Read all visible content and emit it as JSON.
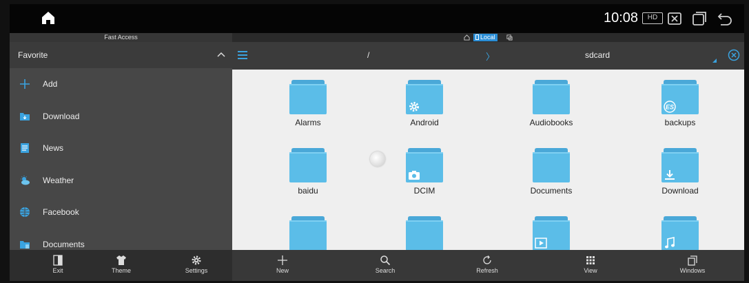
{
  "status_bar": {
    "time": "10:08",
    "hd_label": "HD",
    "icons": [
      "home-icon",
      "screenshot-icon",
      "recent-apps-icon",
      "back-icon"
    ]
  },
  "sidebar": {
    "header": "Fast Access",
    "section_title": "Favorite",
    "items": [
      {
        "label": "Add",
        "icon": "plus-icon"
      },
      {
        "label": "Download",
        "icon": "download-folder-icon"
      },
      {
        "label": "News",
        "icon": "news-icon"
      },
      {
        "label": "Weather",
        "icon": "weather-icon"
      },
      {
        "label": "Facebook",
        "icon": "globe-icon"
      },
      {
        "label": "Documents",
        "icon": "documents-icon"
      }
    ]
  },
  "location": {
    "selected": "Local"
  },
  "path_bar": {
    "root": "/",
    "separator": "〉",
    "current": "sdcard"
  },
  "folders": [
    {
      "name": "Alarms",
      "overlay": ""
    },
    {
      "name": "Android",
      "overlay": "gear-icon"
    },
    {
      "name": "Audiobooks",
      "overlay": ""
    },
    {
      "name": "backups",
      "overlay": "es-logo-icon"
    },
    {
      "name": "baidu",
      "overlay": ""
    },
    {
      "name": "DCIM",
      "overlay": "camera-icon"
    },
    {
      "name": "Documents",
      "overlay": ""
    },
    {
      "name": "Download",
      "overlay": "download-icon"
    },
    {
      "name": "",
      "overlay": ""
    },
    {
      "name": "",
      "overlay": ""
    },
    {
      "name": "",
      "overlay": "play-icon"
    },
    {
      "name": "",
      "overlay": "music-note-icon"
    }
  ],
  "toolbar_left": {
    "exit": "Exit",
    "theme": "Theme",
    "settings": "Settings"
  },
  "toolbar_right": {
    "new": "New",
    "search": "Search",
    "refresh": "Refresh",
    "view": "View",
    "windows": "Windows"
  },
  "colors": {
    "accent": "#3aa3e0",
    "folder": "#5bbde8",
    "folder_tab": "#4aa8d8",
    "sidebar_bg": "#474747",
    "grid_bg": "#efefef"
  }
}
